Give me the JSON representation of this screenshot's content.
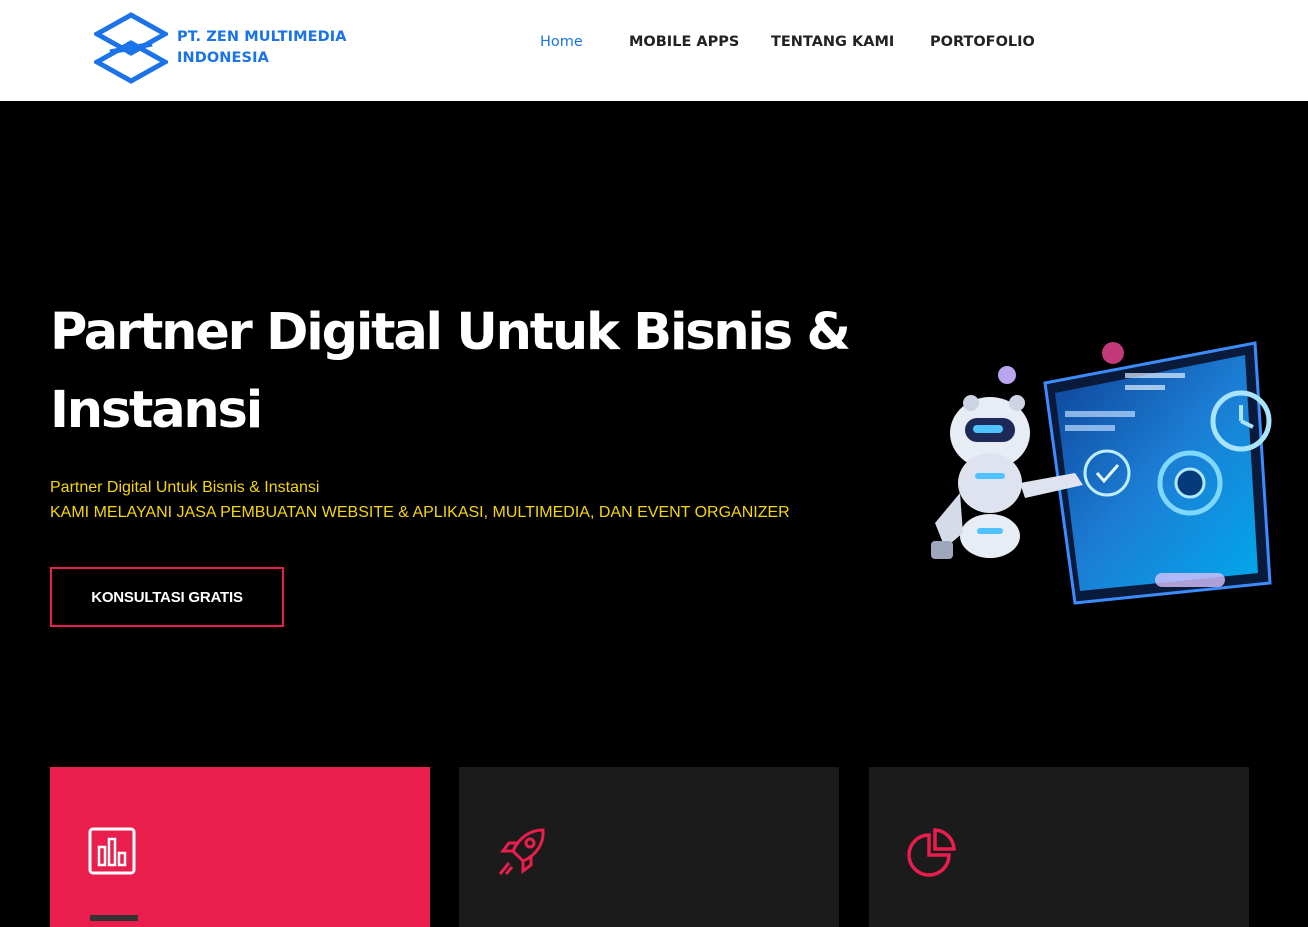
{
  "brand": {
    "line1": "PT. ZEN MULTIMEDIA",
    "line2": "INDONESIA",
    "color": "#1a73e8"
  },
  "nav": {
    "items": [
      {
        "label": "Home",
        "active": true
      },
      {
        "label": "MOBILE APPS",
        "active": false
      },
      {
        "label": "TENTANG KAMI",
        "active": false
      },
      {
        "label": "PORTOFOLIO",
        "active": false
      }
    ]
  },
  "hero": {
    "title": "Partner Digital Untuk Bisnis & Instansi",
    "subtitle": "Partner Digital Untuk Bisnis & Instansi",
    "tagline": "KAMI MELAYANI JASA PEMBUATAN WEBSITE & APLIKASI, MULTIMEDIA, DAN EVENT ORGANIZER",
    "cta_label": "KONSULTASI GRATIS"
  },
  "features": [
    {
      "icon": "bar-chart-icon",
      "bg": "#e91e4d"
    },
    {
      "icon": "rocket-icon",
      "bg": "#1b1b1b"
    },
    {
      "icon": "pie-chart-icon",
      "bg": "#1b1b1b"
    }
  ],
  "colors": {
    "accent": "#e91e4d",
    "tagline": "#f5d60a",
    "link": "#1a73e8"
  }
}
